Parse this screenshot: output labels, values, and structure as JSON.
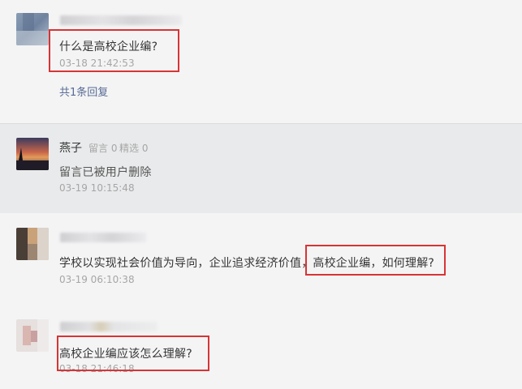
{
  "comments": [
    {
      "content": "什么是高校企业编?",
      "time": "03-18 21:42:53",
      "reply_count_label": "共1条回复"
    },
    {
      "username": "燕子",
      "message_label": "留言",
      "message_count": "0",
      "featured_label": "精选",
      "featured_count": "0",
      "content": "留言已被用户删除",
      "time": "03-19 10:15:48"
    },
    {
      "content_prefix": "学校以实现社会价值为导向，企业追求经济价值，",
      "content_highlight": "高校企业编，如何理解?",
      "time": "03-19 06:10:38"
    },
    {
      "content": "高校企业编应该怎么理解?",
      "time": "03-18 21:46:18"
    }
  ],
  "colors": {
    "highlight_box": "#d83434",
    "link": "#576b95",
    "meta": "#a6a6a6",
    "text": "#353535"
  }
}
